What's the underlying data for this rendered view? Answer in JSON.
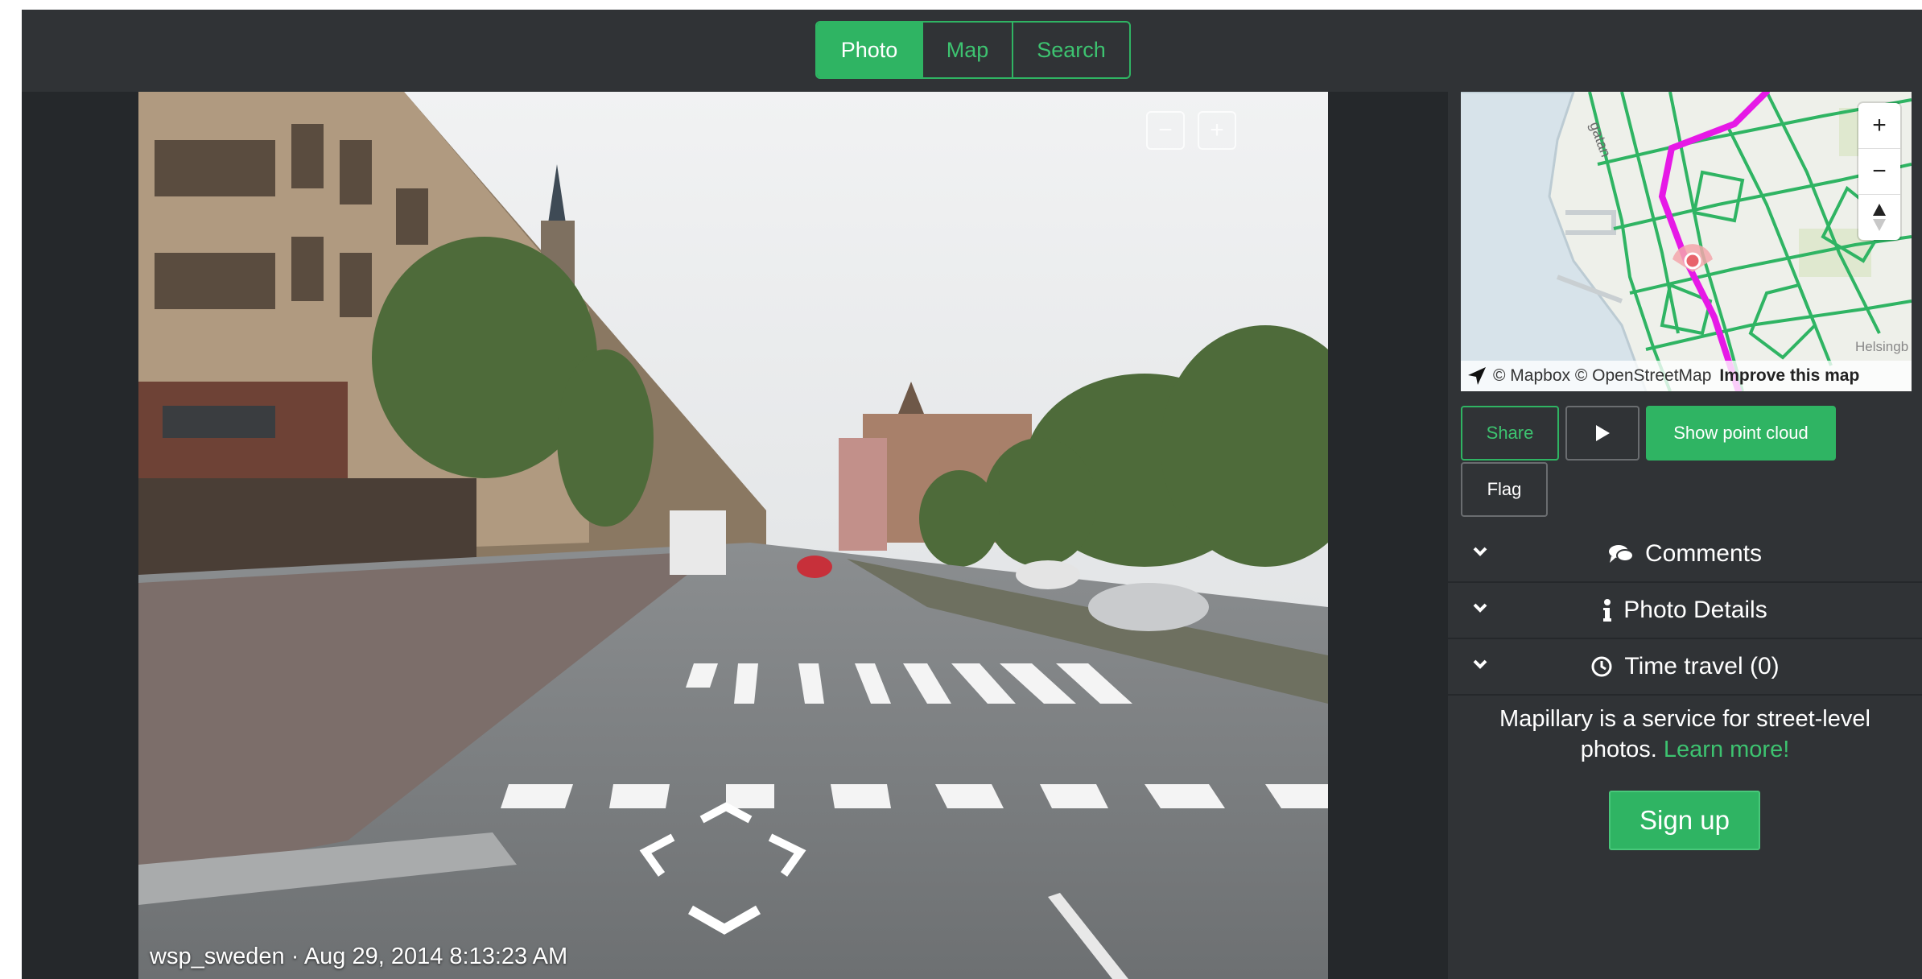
{
  "tabs": [
    {
      "label": "Photo",
      "active": true
    },
    {
      "label": "Map",
      "active": false
    },
    {
      "label": "Search",
      "active": false
    }
  ],
  "viewer": {
    "caption": "wsp_sweden · Aug 29, 2014 8:13:23 AM",
    "zoom_out_icon": "minus-square-icon",
    "zoom_in_icon": "plus-square-icon",
    "nav_icons": [
      "arrow-forward-icon",
      "arrow-left-icon",
      "arrow-right-icon",
      "arrow-back-icon"
    ]
  },
  "minimap": {
    "zoom_in": "+",
    "zoom_out": "−",
    "compass_icon": "compass-icon",
    "place_label": "Helsingb",
    "street_label": "gatan",
    "attribution": "© Mapbox © OpenStreetMap",
    "improve_link": "Improve this map",
    "route_color": "#e619e6",
    "road_color": "#2fb463"
  },
  "actions": {
    "share": "Share",
    "play_icon": "play-icon",
    "point_cloud": "Show point cloud",
    "flag": "Flag"
  },
  "sections": [
    {
      "label": "Comments",
      "icon": "comments-icon"
    },
    {
      "label": "Photo Details",
      "icon": "info-icon"
    },
    {
      "label": "Time travel (0)",
      "icon": "clock-icon"
    }
  ],
  "promo": {
    "text": "Mapillary is a service for street-level photos.",
    "link": "Learn more!",
    "signup": "Sign up"
  },
  "colors": {
    "accent": "#2fb463",
    "panel": "#303336",
    "background": "#25282b"
  }
}
